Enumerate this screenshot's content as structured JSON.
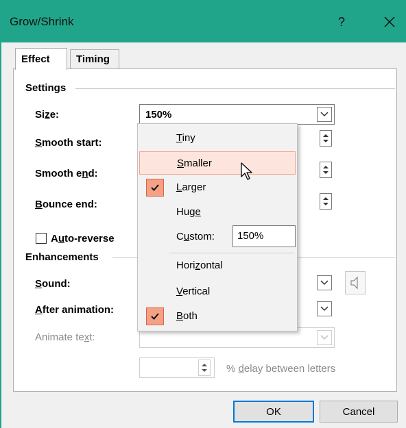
{
  "window": {
    "title": "Grow/Shrink",
    "help": "?",
    "close_icon": "close-icon"
  },
  "tabs": [
    {
      "label": "Effect",
      "active": true
    },
    {
      "label": "Timing",
      "active": false
    }
  ],
  "settings": {
    "group_label": "Settings",
    "size_label": "Size:",
    "size_value": "150%",
    "smooth_start_label": "Smooth start:",
    "smooth_end_label": "Smooth end:",
    "bounce_end_label": "Bounce end:",
    "auto_reverse_label": "Auto-reverse",
    "auto_reverse_checked": false
  },
  "enhancements": {
    "group_label": "Enhancements",
    "sound_label": "Sound:",
    "after_animation_label": "After animation:",
    "animate_text_label": "Animate text:",
    "delay_label": "% delay between letters"
  },
  "size_menu": {
    "items": [
      {
        "label": "Tiny",
        "checked": false,
        "highlighted": false
      },
      {
        "label": "Smaller",
        "checked": false,
        "highlighted": true
      },
      {
        "label": "Larger",
        "checked": true,
        "highlighted": false
      },
      {
        "label": "Huge",
        "checked": false,
        "highlighted": false
      }
    ],
    "custom_label": "Custom:",
    "custom_value": "150%",
    "direction_items": [
      {
        "label": "Horizontal",
        "checked": false
      },
      {
        "label": "Vertical",
        "checked": false
      },
      {
        "label": "Both",
        "checked": true
      }
    ]
  },
  "buttons": {
    "ok": "OK",
    "cancel": "Cancel"
  },
  "colors": {
    "titlebar": "#20a58a",
    "highlight": "#fde4dc",
    "check_bg": "#f4a285",
    "default_button_border": "#0078d7"
  }
}
